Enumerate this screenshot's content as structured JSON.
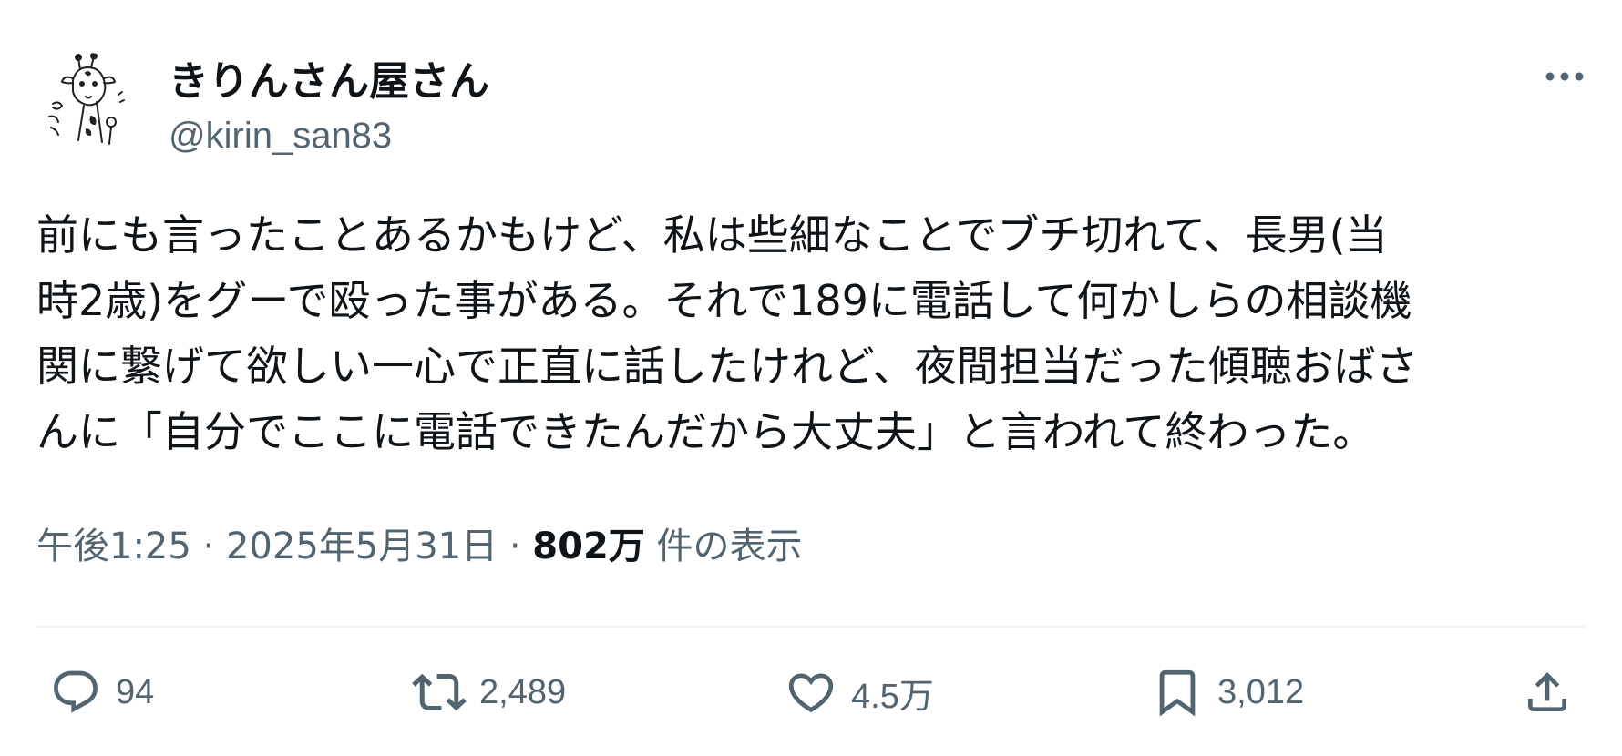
{
  "author": {
    "display_name": "きりんさん屋さん",
    "handle": "@kirin_san83",
    "avatar_icon": "giraffe-drawing-avatar"
  },
  "post": {
    "text": "前にも言ったことあるかもけど、私は些細なことでブチ切れて、長男(当\n時2歳)をグーで殴った事がある。それで189に電話して何かしらの相談機\n関に繋げて欲しい一心で正直に話したけれど、夜間担当だった傾聴おばさ\nんに「自分でここに電話できたんだから大丈夫」と言われて終わった。"
  },
  "meta": {
    "time": "午後1:25",
    "separator": "·",
    "date": "2025年5月31日",
    "views_count": "802万",
    "views_label": "件の表示"
  },
  "actions": {
    "reply_count": "94",
    "retweet_count": "2,489",
    "like_count": "4.5万",
    "bookmark_count": "3,012"
  },
  "icons": {
    "more": "more-horizontal-icon",
    "reply": "reply-bubble-icon",
    "retweet": "retweet-icon",
    "like": "heart-icon",
    "bookmark": "bookmark-icon",
    "share": "share-upload-icon"
  },
  "colors": {
    "text_primary": "#0f1419",
    "text_secondary": "#536471",
    "divider": "#eff3f4"
  }
}
